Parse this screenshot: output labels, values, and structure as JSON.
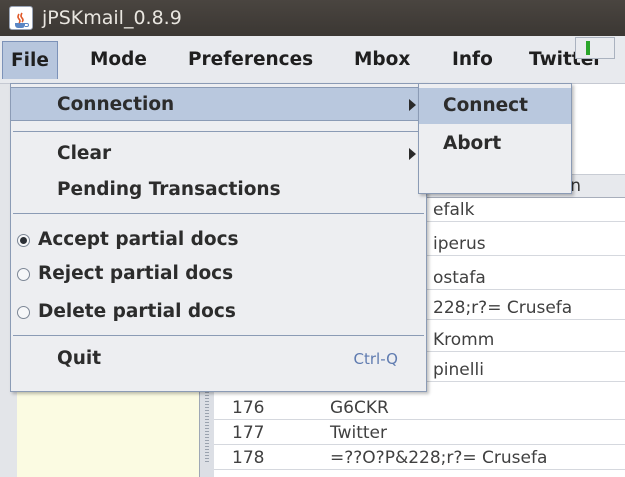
{
  "window": {
    "title": "jPSKmail_0.8.9",
    "app_icon": "java-cup-icon"
  },
  "menubar": {
    "items": [
      {
        "label": "File",
        "active": true
      },
      {
        "label": "Mode"
      },
      {
        "label": "Preferences"
      },
      {
        "label": "Mbox"
      },
      {
        "label": "Info"
      },
      {
        "label": "Twitter"
      }
    ]
  },
  "file_menu": {
    "connection": "Connection",
    "clear": "Clear",
    "pending": "Pending Transactions",
    "accept_partial": "Accept partial docs",
    "reject_partial": "Reject partial docs",
    "delete_partial": "Delete partial docs",
    "quit": "Quit",
    "quit_accel": "Ctrl-Q",
    "selected_radio": "accept_partial"
  },
  "connection_submenu": {
    "connect": "Connect",
    "abort": "Abort"
  },
  "table": {
    "header_fragment": "n",
    "rows": [
      {
        "num": "",
        "name": "",
        "fragment": "efalk"
      },
      {
        "num": "",
        "name": "",
        "fragment": "iperus"
      },
      {
        "num": "",
        "name": "",
        "fragment": "ostafa"
      },
      {
        "num": "",
        "name": "",
        "fragment": "228;r?= Crusefa"
      },
      {
        "num": "",
        "name": "",
        "fragment": "Kromm"
      },
      {
        "num": "",
        "name": "",
        "fragment": "pinelli"
      },
      {
        "num": "176",
        "name": "G6CKR",
        "fragment": ""
      },
      {
        "num": "177",
        "name": "Twitter",
        "fragment": ""
      },
      {
        "num": "178",
        "name": "=??O?P&228;r?= Crusefa",
        "fragment": ""
      }
    ]
  },
  "colors": {
    "menu_highlight": "#b9c8de",
    "left_pane": "#fbfbe2",
    "accent": "#5f7bb0",
    "status_green": "#2aa52a"
  }
}
